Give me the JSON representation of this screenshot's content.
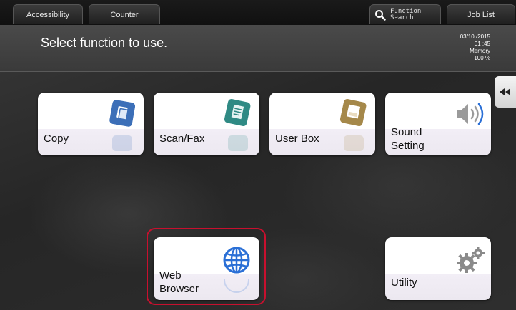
{
  "topbar": {
    "accessibility_label": "Accessibility",
    "counter_label": "Counter",
    "function_search_line1": "Function",
    "function_search_line2": "Search",
    "job_list_label": "Job List"
  },
  "header": {
    "title": "Select function to use.",
    "date": "03/10 /2015",
    "time": "01 :45",
    "memory_label": "Memory",
    "memory_value": "100 %"
  },
  "functions": {
    "copy": {
      "label": "Copy",
      "icon": "copy-icon"
    },
    "scan_fax": {
      "label": "Scan/Fax",
      "icon": "scan-fax-icon"
    },
    "user_box": {
      "label": "User Box",
      "icon": "user-box-icon"
    },
    "sound_setting": {
      "line1": "Sound",
      "line2": "Setting",
      "icon": "speaker-icon"
    },
    "web_browser": {
      "line1": "Web",
      "line2": "Browser",
      "icon": "globe-icon"
    },
    "utility": {
      "label": "Utility",
      "icon": "gears-icon"
    }
  },
  "colors": {
    "highlight": "#c8102e",
    "copy_icon": "#3c6fb8",
    "scan_icon": "#2f8a84",
    "userbox_icon": "#a5884a",
    "globe_icon": "#2a6fd6"
  }
}
